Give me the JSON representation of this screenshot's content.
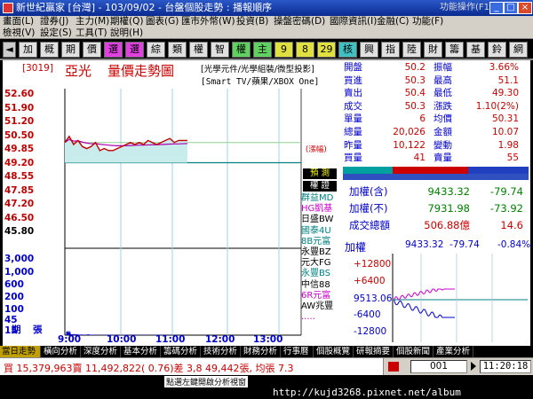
{
  "titlebar": {
    "title": "新世紀贏家 [台灣] - 103/09/02 - 台盤個股走勢 : 播報順序",
    "help": "功能操作(F1)"
  },
  "menu": {
    "row1": [
      "畫面(L)",
      "證券(J)",
      "主力(M)",
      "期權(Q)",
      "圖表(G)",
      "匯市外幣(W)",
      "投資(B)",
      "操盤密碼(D)",
      "國際資訊(I)",
      "金融(C)",
      "功能(F)"
    ],
    "row2": [
      "檢視(V)",
      "設定(S)",
      "工具(T)",
      "說明(H)"
    ]
  },
  "toolbar": {
    "buttons": [
      "加",
      "概",
      "期",
      "價",
      "選",
      "選",
      "綜",
      "類",
      "權",
      "智",
      "權",
      "主",
      "9",
      "8",
      "29",
      "核",
      "興",
      "指",
      "陸",
      "財",
      "籌",
      "基",
      "鈴",
      "網"
    ]
  },
  "chart": {
    "code": "[3019]",
    "name": "亞光",
    "title": "量價走勢圖",
    "tags1": "[光學元件/光學組裝/微型投影]",
    "tags2": "[Smart TV/蘋果/XBOX One]",
    "limit_label": "(漲幅)",
    "yticks": [
      "52.60",
      "51.90",
      "51.20",
      "50.50",
      "49.85",
      "49.20",
      "48.55",
      "47.85",
      "47.20",
      "46.50",
      "45.80"
    ],
    "volticks": [
      "3,000",
      "1,000",
      "600",
      "200",
      "100",
      "45",
      "15"
    ],
    "vol_label": "張",
    "xticks": [
      "9:00",
      "10:00",
      "11:00",
      "12:00",
      "13:00"
    ],
    "period_label": "期"
  },
  "chart_data": {
    "type": "line",
    "xlabel": "",
    "ylabel": "",
    "x": [
      "09:00",
      "09:05",
      "09:10",
      "09:15",
      "09:20",
      "09:25",
      "09:30",
      "09:35",
      "09:40",
      "09:45",
      "09:50",
      "09:55",
      "10:00",
      "10:05",
      "10:10",
      "10:15",
      "10:20",
      "10:25",
      "10:30",
      "10:35",
      "10:40",
      "10:45",
      "10:50",
      "10:55",
      "11:00",
      "11:05",
      "11:10",
      "11:15",
      "11:20"
    ],
    "series": [
      {
        "name": "price",
        "values": [
          50.2,
          50.5,
          50.1,
          50.3,
          50.0,
          49.9,
          50.0,
          50.2,
          49.8,
          49.9,
          49.8,
          49.8,
          49.9,
          50.0,
          50.1,
          50.2,
          50.1,
          50.2,
          50.1,
          50.3,
          50.2,
          50.1,
          50.2,
          50.3,
          50.4,
          50.2,
          50.3,
          50.3,
          50.3
        ]
      },
      {
        "name": "average",
        "values": [
          50.2,
          50.35,
          50.27,
          50.28,
          50.22,
          50.17,
          50.14,
          50.15,
          50.11,
          50.09,
          50.07,
          50.05,
          50.04,
          50.04,
          50.04,
          50.05,
          50.06,
          50.07,
          50.07,
          50.08,
          50.09,
          50.09,
          50.1,
          50.11,
          50.12,
          50.13,
          50.13,
          50.14,
          50.15
        ]
      }
    ],
    "ylim": [
      45.8,
      52.6
    ],
    "prev_close": 49.2,
    "volume_scale": [
      15,
      45,
      100,
      200,
      600,
      1000,
      3000
    ]
  },
  "brokers": {
    "header1": "預 測",
    "header2": "權 證",
    "items": [
      {
        "label": "群益MD",
        "color": "#008080"
      },
      {
        "label": "HG凱基",
        "color": "#cc00cc"
      },
      {
        "label": "日盛BW",
        "color": "#000000"
      },
      {
        "label": "國泰4U",
        "color": "#008080"
      },
      {
        "label": "8B元富",
        "color": "#008080"
      },
      {
        "label": "永豐BZ",
        "color": "#000000"
      },
      {
        "label": "元大FG",
        "color": "#000000"
      },
      {
        "label": "永豐BS",
        "color": "#008080"
      },
      {
        "label": "中信88",
        "color": "#000000"
      },
      {
        "label": "6R元富",
        "color": "#cc00cc"
      },
      {
        "label": "AW兆豐",
        "color": "#000000"
      }
    ],
    "more": "....."
  },
  "quote": {
    "rows": [
      {
        "l": "開盤",
        "lv": "50.2",
        "r": "振幅",
        "rv": "3.66%"
      },
      {
        "l": "買進",
        "lv": "50.3",
        "r": "最高",
        "rv": "51.1"
      },
      {
        "l": "賣出",
        "lv": "50.4",
        "r": "最低",
        "rv": "49.30"
      },
      {
        "l": "成交",
        "lv": "50.3",
        "r": "漲跌",
        "rv": "1.10(2%)"
      },
      {
        "l": "單量",
        "lv": "6",
        "r": "均價",
        "rv": "50.31"
      },
      {
        "l": "總量",
        "lv": "20,026",
        "r": "金額",
        "rv": "10.07"
      },
      {
        "l": "昨量",
        "lv": "10,122",
        "r": "變動",
        "rv": "1.98"
      },
      {
        "l": "買量",
        "lv": "41",
        "r": "賣量",
        "rv": "55"
      }
    ],
    "idx_rows": [
      {
        "l": "加權(含)",
        "v": "9433.32",
        "c": "-79.74"
      },
      {
        "l": "加權(不)",
        "v": "7931.98",
        "c": "-73.92"
      },
      {
        "l": "成交總額",
        "v": "506.88億",
        "c": "14.6"
      }
    ]
  },
  "mini": {
    "title": "加權",
    "value": "9433.32",
    "change": "-79.74",
    "pct": "-0.84%",
    "yticks": [
      "+12800",
      "+6400",
      "9513.06",
      "-6400",
      "-12800"
    ]
  },
  "tabs": [
    "當日走勢",
    "橫向分析",
    "深度分析",
    "基本分析",
    "籌碼分析",
    "技術分析",
    "財務分析",
    "行事曆",
    "個股概覽",
    "研報摘要",
    "個股新聞",
    "產業分析"
  ],
  "status": {
    "text": "買 15,379,963賣 11,492,822( 0.76)差 3,8 49,442張, 均張 7.3",
    "page": "001",
    "time": "11:20:18"
  },
  "hint": "點選左鍵開啟分析視窗",
  "watermark": "http://kujd3268.pixnet.net/album",
  "colors": {
    "up": "#cc0000",
    "down": "#008000",
    "accent": "#0000cc",
    "panel": "#ffffff"
  }
}
